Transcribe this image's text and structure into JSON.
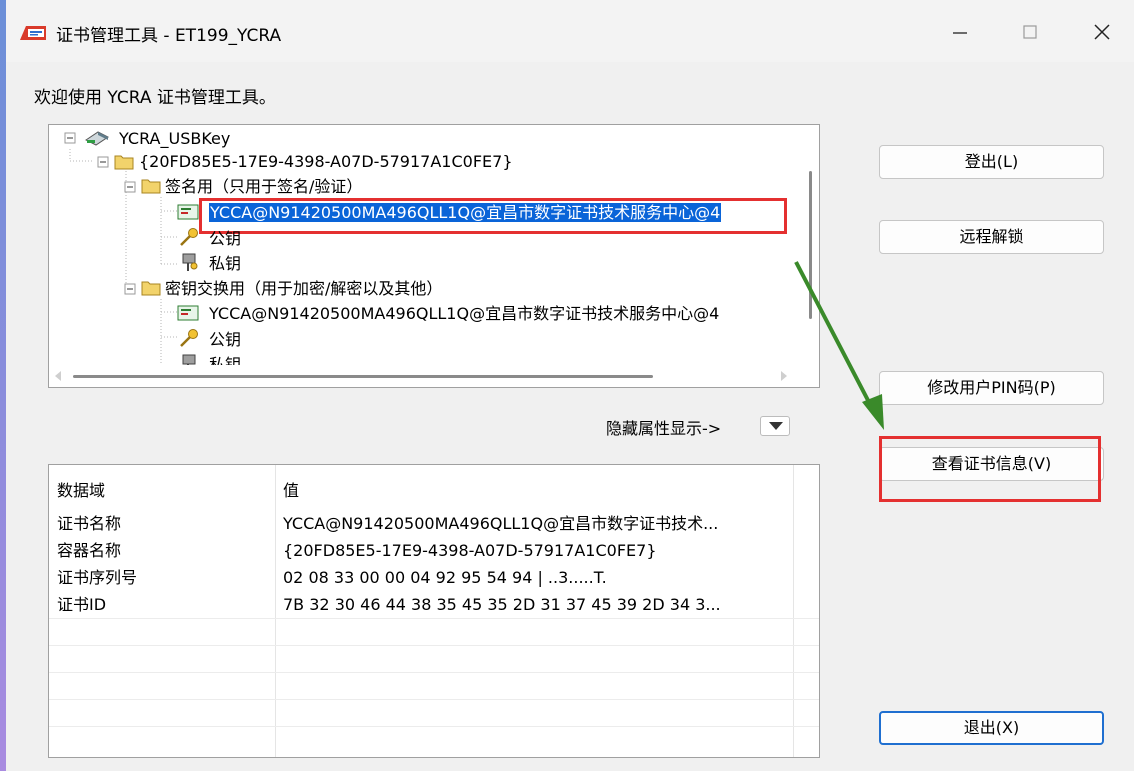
{
  "window": {
    "title": "证书管理工具 - ET199_YCRA",
    "minimize_symbol": "—",
    "maximize_symbol": "☐",
    "close_symbol": "✕"
  },
  "welcome_text": "欢迎使用 YCRA 证书管理工具。",
  "tree": {
    "root": "YCRA_USBKey",
    "container": "{20FD85E5-17E9-4398-A07D-57917A1C0FE7}",
    "sign_folder": "签名用（只用于签名/验证）",
    "sign_cert": "YCCA@N91420500MA496QLL1Q@宜昌市数字证书技术服务中心@4",
    "sign_public_key": "公钥",
    "sign_private_key": "私钥",
    "exchange_folder": "密钥交换用（用于加密/解密以及其他）",
    "exchange_cert": "YCCA@N91420500MA496QLL1Q@宜昌市数字证书技术服务中心@4",
    "exchange_public_key": "公钥",
    "exchange_private_key": "私钥"
  },
  "attr_toggle_label": "隐藏属性显示->",
  "properties": {
    "headers": [
      "数据域",
      "值"
    ],
    "rows": [
      [
        "证书名称",
        "YCCA@N91420500MA496QLL1Q@宜昌市数字证书技术..."
      ],
      [
        "容器名称",
        "{20FD85E5-17E9-4398-A07D-57917A1C0FE7}"
      ],
      [
        "证书序列号",
        "02 08 33 00 00 04 92 95 54 94   |   ..3.....T."
      ],
      [
        "证书ID",
        "7B 32 30 46 44 38 35 45 35 2D 31 37 45 39 2D 34 3..."
      ]
    ]
  },
  "buttons": {
    "logout": "登出(L)",
    "remote_unlock": "远程解锁",
    "change_pin": "修改用户PIN码(P)",
    "view_cert": "查看证书信息(V)",
    "exit": "退出(X)"
  },
  "colors": {
    "selection": "#0a64d8",
    "highlight_box": "#e43030",
    "annotation_arrow": "#3a8a2a",
    "primary_border": "#1f6fd0"
  },
  "icons": {
    "app": "certificate-app-icon",
    "usb_key": "usb-key-icon",
    "folder": "folder-icon",
    "certificate": "certificate-icon",
    "public_key": "key-icon",
    "private_key": "private-key-icon",
    "dropdown": "triangle-down-icon"
  }
}
